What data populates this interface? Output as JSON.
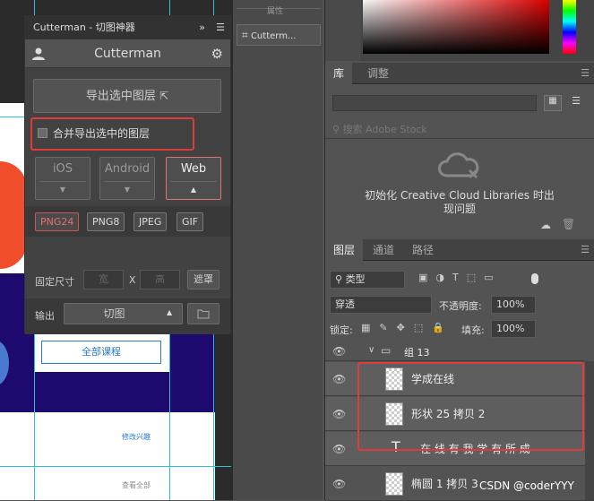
{
  "cutterman": {
    "window_title": "Cutterman - 切图神器",
    "expand": "»",
    "app_name": "Cutterman",
    "export_label": "导出选中图层",
    "merge_label": "合并导出选中的图层",
    "platforms": [
      "iOS",
      "Android",
      "Web"
    ],
    "formats": [
      "PNG24",
      "PNG8",
      "JPEG",
      "GIF"
    ],
    "fixed_size_label": "固定尺寸",
    "width_placeholder": "宽",
    "x_label": "X",
    "height_placeholder": "高",
    "mask_label": "遮罩",
    "output_label": "输出",
    "output_value": "切图"
  },
  "mid_panel": {
    "top_label": "属性",
    "item_label": "Cutterm..."
  },
  "library": {
    "tabs": [
      "库",
      "调整"
    ],
    "search_placeholder": "搜索 Adobe Stock",
    "message_line1": "初始化 Creative Cloud Libraries 时出",
    "message_line2": "现问题"
  },
  "layers": {
    "tabs": [
      "图层",
      "通道",
      "路径"
    ],
    "filter_value": "类型",
    "blend_value": "穿透",
    "opacity_label": "不透明度:",
    "opacity_value": "100%",
    "lock_label": "锁定:",
    "fill_label": "填充:",
    "fill_value": "100%",
    "group_name": "组 13",
    "rows": [
      {
        "name": "学成在线"
      },
      {
        "name": "形状 25 拷贝 2"
      },
      {
        "name": "在 线 有 我   学 有 所 成"
      },
      {
        "name": "椭圆 1 拷贝 3"
      }
    ]
  },
  "canvas": {
    "all_courses": "全部课程",
    "edit_interest": "修改兴趣",
    "view_all": "查看全部"
  },
  "watermark": "CSDN @coderYYY",
  "colors": {
    "highlight": "#e03b3b",
    "web_active": "#e57070",
    "png24": "#e57070"
  }
}
